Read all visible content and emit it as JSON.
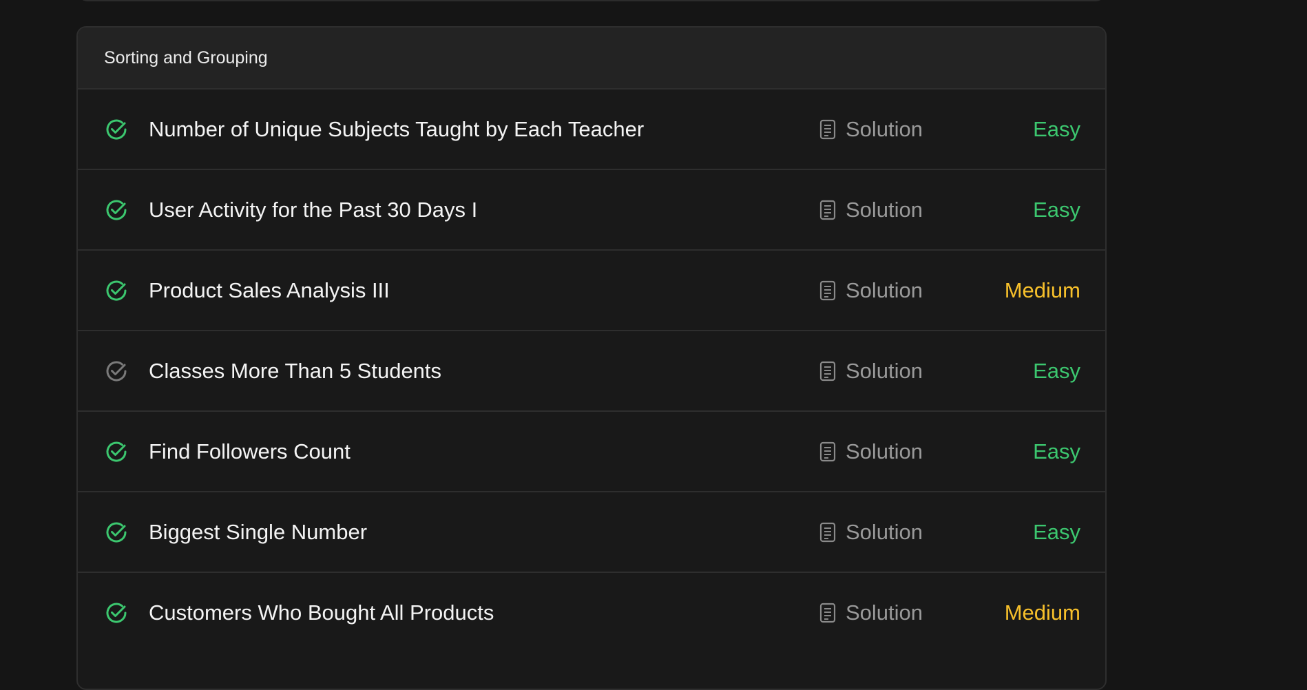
{
  "section": {
    "title": "Sorting and Grouping"
  },
  "colors": {
    "easy": "#3cc76f",
    "medium": "#f7c02b",
    "solved": "#3cc76f",
    "attempted": "#7a7a7a"
  },
  "rows": [
    {
      "title": "Number of Unique Subjects Taught by Each Teacher",
      "solution_label": "Solution",
      "difficulty": "Easy",
      "status": "solved"
    },
    {
      "title": "User Activity for the Past 30 Days I",
      "solution_label": "Solution",
      "difficulty": "Easy",
      "status": "solved"
    },
    {
      "title": "Product Sales Analysis III",
      "solution_label": "Solution",
      "difficulty": "Medium",
      "status": "solved"
    },
    {
      "title": "Classes More Than 5 Students",
      "solution_label": "Solution",
      "difficulty": "Easy",
      "status": "attempted"
    },
    {
      "title": "Find Followers Count",
      "solution_label": "Solution",
      "difficulty": "Easy",
      "status": "solved"
    },
    {
      "title": "Biggest Single Number",
      "solution_label": "Solution",
      "difficulty": "Easy",
      "status": "solved"
    },
    {
      "title": "Customers Who Bought All Products",
      "solution_label": "Solution",
      "difficulty": "Medium",
      "status": "solved"
    }
  ],
  "icons": {
    "status": "check-circle-icon",
    "solution": "document-icon"
  }
}
